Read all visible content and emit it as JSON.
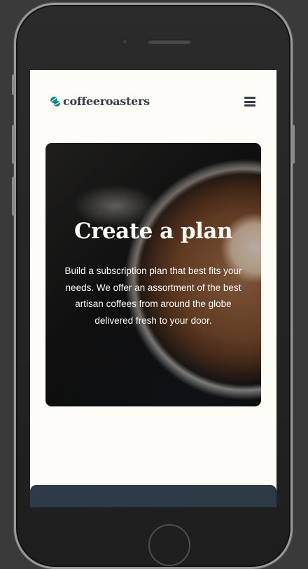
{
  "brand": {
    "name": "coffeeroasters",
    "icon": "coffee-beans-icon",
    "accent_color": "#0e8784",
    "text_color": "#333d4b"
  },
  "nav": {
    "menu_icon": "hamburger-menu-icon"
  },
  "hero": {
    "title": "Create a plan",
    "description": "Build a subscription plan that best fits your needs. We offer an assortment of the best artisan coffees from around the globe delivered fresh to your door."
  },
  "colors": {
    "page_background": "#fefcf7",
    "dark_section": "#2c3a46"
  }
}
